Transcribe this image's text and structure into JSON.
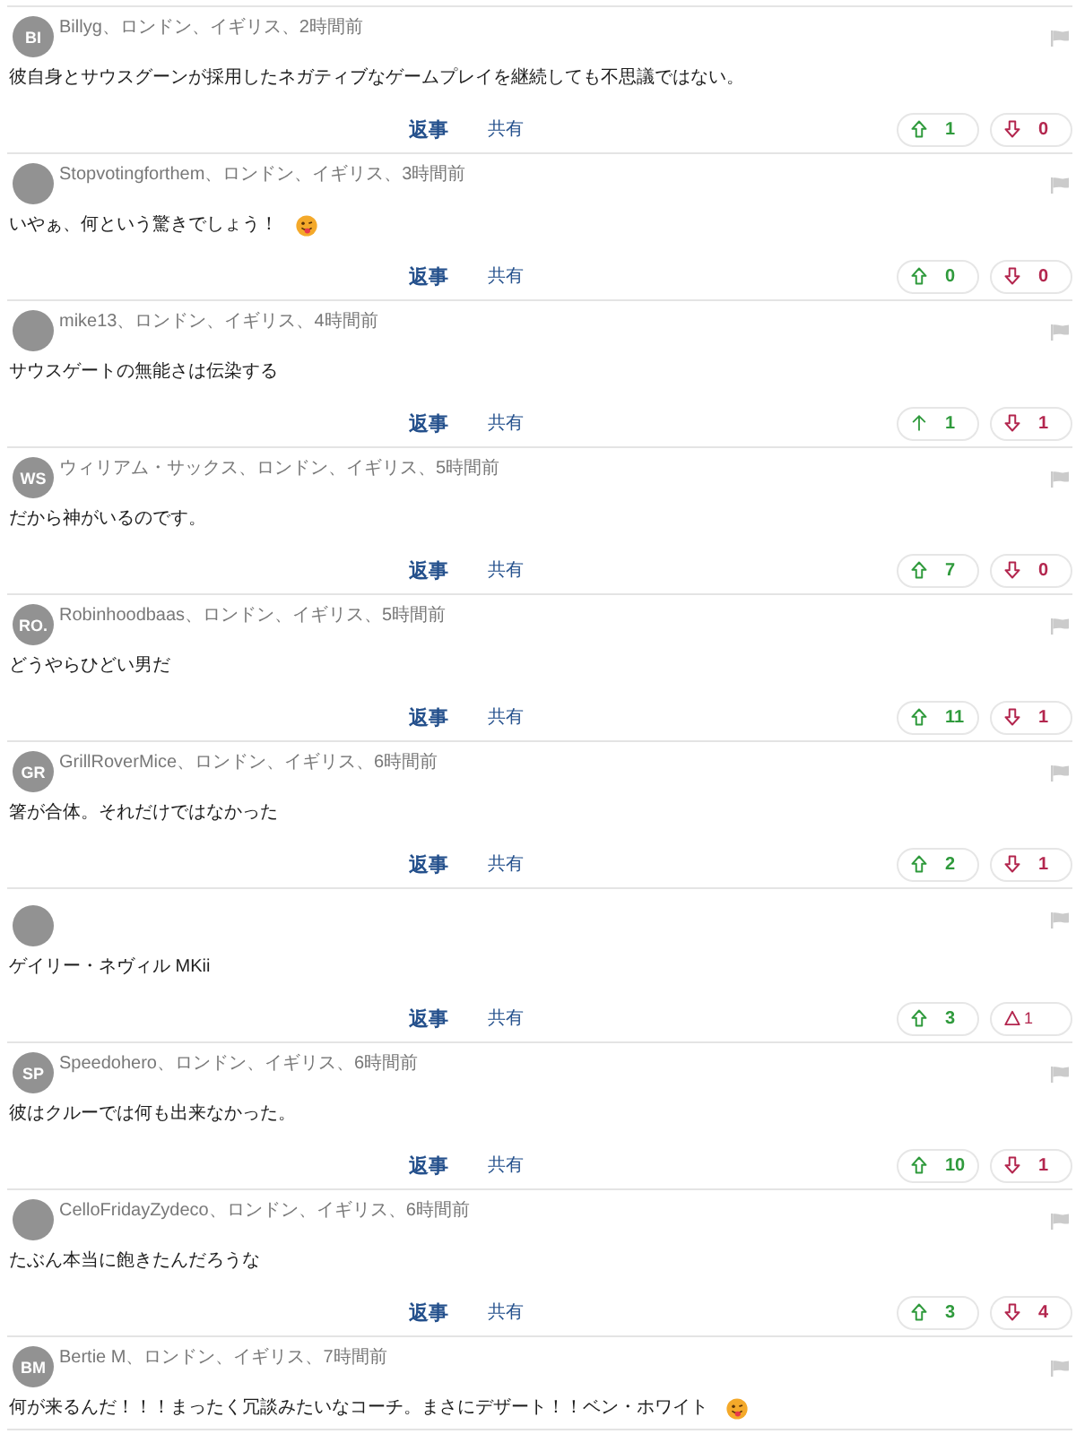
{
  "comments": [
    {
      "avatar_initials": "BI",
      "author": "Billyg、ロンドン、イギリス、2時間前",
      "body": "彼自身とサウスグーンが採用したネガティブなゲームプレイを継続しても不思議ではない。",
      "emoji": false,
      "reply": "返事",
      "share": "共有",
      "upvote": {
        "kind": "block_arrow",
        "count": "1"
      },
      "downvote": {
        "kind": "block_arrow",
        "count": "0"
      }
    },
    {
      "author": "Stopvotingforthem、ロンドン、イギリス、3時間前",
      "body": "いやぁ、何という驚きでしょう！",
      "emoji": true,
      "reply": "返事",
      "share": "共有",
      "upvote": {
        "kind": "block_arrow",
        "count": "0"
      },
      "downvote": {
        "kind": "block_arrow",
        "count": "0"
      }
    },
    {
      "author": "mike13、ロンドン、イギリス、4時間前",
      "body": "サウスゲートの無能さは伝染する",
      "emoji": false,
      "reply": "返事",
      "share": "共有",
      "upvote": {
        "kind": "thin_arrow",
        "count": "1"
      },
      "downvote": {
        "kind": "block_arrow",
        "count": "1"
      }
    },
    {
      "avatar_initials": "WS",
      "author": "ウィリアム・サックス、ロンドン、イギリス、5時間前",
      "body": "だから神がいるのです。",
      "emoji": false,
      "reply": "返事",
      "share": "共有",
      "upvote": {
        "kind": "block_arrow",
        "count": "7"
      },
      "downvote": {
        "kind": "block_arrow",
        "count": "0"
      }
    },
    {
      "avatar_initials": "RO.",
      "author": "Robinhoodbaas、ロンドン、イギリス、5時間前",
      "body": "どうやらひどい男だ",
      "emoji": false,
      "reply": "返事",
      "share": "共有",
      "upvote": {
        "kind": "block_arrow",
        "count": "11"
      },
      "downvote": {
        "kind": "block_arrow",
        "count": "1"
      }
    },
    {
      "avatar_initials": "GR",
      "author": "GrillRoverMice、ロンドン、イギリス、6時間前",
      "body": "箸が合体。それだけではなかった",
      "emoji": false,
      "reply": "返事",
      "share": "共有",
      "upvote": {
        "kind": "block_arrow",
        "count": "2"
      },
      "downvote": {
        "kind": "block_arrow",
        "count": "1"
      }
    },
    {
      "body": "ゲイリー・ネヴィル MKii",
      "emoji": false,
      "reply": "返事",
      "share": "共有",
      "upvote": {
        "kind": "block_arrow",
        "count": "3"
      },
      "downvote": {
        "kind": "triangle",
        "count": "1"
      }
    },
    {
      "avatar_initials": "SP",
      "author": "Speedohero、ロンドン、イギリス、6時間前",
      "body": "彼はクルーでは何も出来なかった。",
      "emoji": false,
      "reply": "返事",
      "share": "共有",
      "upvote": {
        "kind": "block_arrow",
        "count": "10"
      },
      "downvote": {
        "kind": "block_arrow",
        "count": "1"
      }
    },
    {
      "author": "CelloFridayZydeco、ロンドン、イギリス、6時間前",
      "body": "たぶん本当に飽きたんだろうな",
      "emoji": false,
      "reply": "返事",
      "share": "共有",
      "upvote": {
        "kind": "block_arrow",
        "count": "3"
      },
      "downvote": {
        "kind": "block_arrow",
        "count": "4"
      }
    },
    {
      "avatar_initials": "BM",
      "author": "Bertie M、ロンドン、イギリス、7時間前",
      "body": "何が来るんだ！！！まったく冗談みたいなコーチ。まさにデザート！！ベン・ホワイト",
      "emoji": true
    }
  ]
}
